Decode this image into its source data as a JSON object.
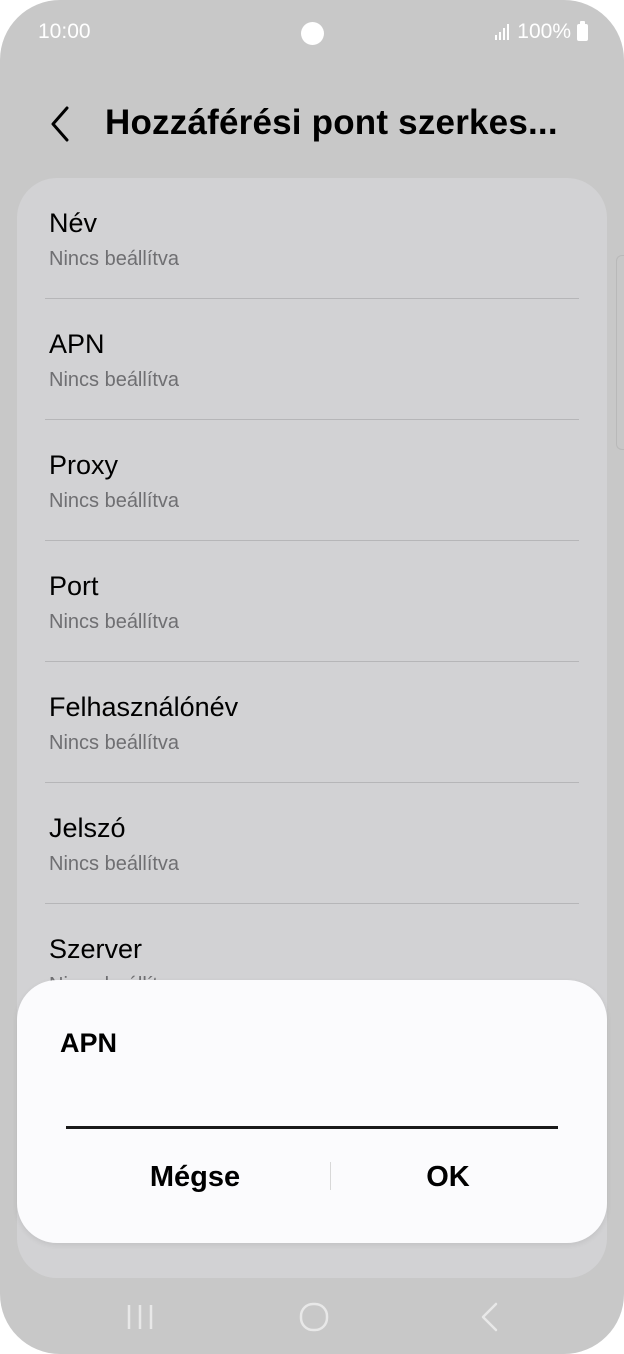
{
  "status_bar": {
    "time": "10:00",
    "battery": "100%",
    "icons": [
      "signal-icon",
      "battery-icon"
    ]
  },
  "header": {
    "title": "Hozzáférési pont szerkes...",
    "back_icon": "chevron-left-icon"
  },
  "settings_list": {
    "items": [
      {
        "label": "Név",
        "value": "Nincs beállítva"
      },
      {
        "label": "APN",
        "value": "Nincs beállítva"
      },
      {
        "label": "Proxy",
        "value": "Nincs beállítva"
      },
      {
        "label": "Port",
        "value": "Nincs beállítva"
      },
      {
        "label": "Felhasználónév",
        "value": "Nincs beállítva"
      },
      {
        "label": "Jelszó",
        "value": "Nincs beállítva"
      },
      {
        "label": "Szerver",
        "value": "Nincs beállítva"
      }
    ]
  },
  "dialog": {
    "title": "APN",
    "input_value": "",
    "cancel_label": "Mégse",
    "ok_label": "OK"
  },
  "nav_bar": {
    "icons": [
      "recent-apps-icon",
      "home-icon",
      "back-icon"
    ]
  },
  "colors": {
    "background": "#c8c8c8",
    "list_card": "#d2d2d4",
    "dialog": "#fbfbfd",
    "subtext": "#6f6f72"
  }
}
